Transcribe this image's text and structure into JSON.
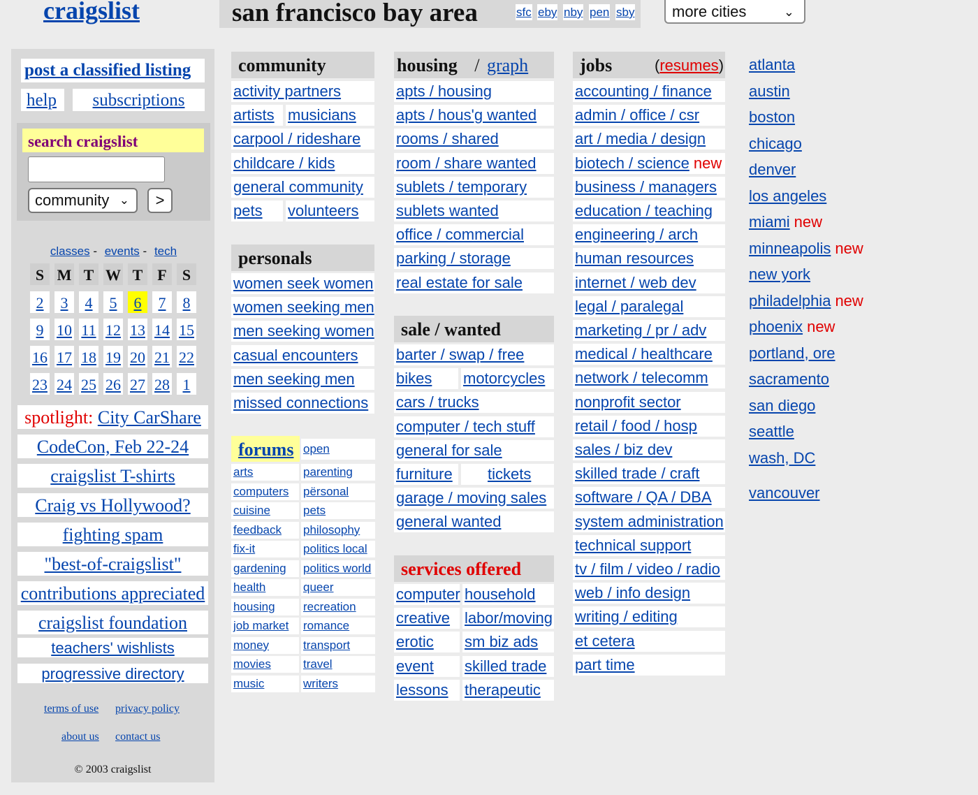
{
  "header": {
    "logo": "craigslist",
    "site_title": "san francisco bay area",
    "subareas": [
      "sfc",
      "eby",
      "nby",
      "pen",
      "sby"
    ],
    "more_cities": "more cities"
  },
  "sidebar": {
    "post_listing": "post a classified listing",
    "help": "help",
    "subscriptions": "subscriptions",
    "search_label": "search craigslist",
    "search_value": "",
    "search_category": "community",
    "go_button": ">",
    "cal_links": [
      "classes",
      "events",
      "tech"
    ],
    "cal_separator": "-",
    "cal_headers": [
      "S",
      "M",
      "T",
      "W",
      "T",
      "F",
      "S"
    ],
    "cal_days": [
      "2",
      "3",
      "4",
      "5",
      "6",
      "7",
      "8",
      "9",
      "10",
      "11",
      "12",
      "13",
      "14",
      "15",
      "16",
      "17",
      "18",
      "19",
      "20",
      "21",
      "22",
      "23",
      "24",
      "25",
      "26",
      "27",
      "28",
      "1"
    ],
    "today": "6",
    "spotlight_label": "spotlight:",
    "spotlight_link": "City CarShare",
    "promo_links": [
      "CodeCon, Feb 22-24",
      "craigslist T-shirts",
      "Craig vs Hollywood?",
      "fighting spam",
      "\"best-of-craigslist\"",
      "contributions appreciated",
      "craigslist foundation"
    ],
    "sans_links": [
      "teachers' wishlists",
      "progressive directory"
    ],
    "footer_links": [
      "terms of use",
      "privacy policy",
      "about us",
      "contact us"
    ],
    "copyright": "© 2003 craigslist"
  },
  "community": {
    "title": "community",
    "rows": [
      [
        "activity partners"
      ],
      [
        "artists",
        "musicians"
      ],
      [
        "carpool / rideshare"
      ],
      [
        "childcare / kids"
      ],
      [
        "general community"
      ],
      [
        "pets",
        "volunteers"
      ]
    ]
  },
  "personals": {
    "title": "personals",
    "rows": [
      "women seek women",
      "women seeking men",
      "men seeking women",
      "casual encounters",
      "men seeking men",
      "missed connections"
    ]
  },
  "forums": {
    "title": "forums",
    "open": "open",
    "left": [
      "arts",
      "computers",
      "cuisine",
      "feedback",
      "fix-it",
      "gardening",
      "health",
      "housing",
      "job market",
      "money",
      "movies",
      "music"
    ],
    "right": [
      "parenting",
      "përsonal",
      "pets",
      "philosophy",
      "politics local",
      "politics world",
      "queer",
      "recreation",
      "romance",
      "transport",
      "travel",
      "writers"
    ]
  },
  "housing": {
    "title": "housing",
    "slash": "/",
    "graph": "graph",
    "rows": [
      "apts / housing",
      "apts / hous'g wanted",
      "rooms / shared",
      "room / share wanted",
      "sublets / temporary",
      "sublets wanted",
      "office / commercial",
      "parking / storage",
      "real estate for sale"
    ]
  },
  "sale": {
    "title": "sale / wanted",
    "rows": [
      [
        "barter / swap / free"
      ],
      [
        "bikes",
        "motorcycles"
      ],
      [
        "cars / trucks"
      ],
      [
        "computer / tech stuff"
      ],
      [
        "general for sale"
      ],
      [
        "furniture",
        "tickets"
      ],
      [
        "garage / moving sales"
      ],
      [
        "general wanted"
      ]
    ]
  },
  "services": {
    "title": "services offered",
    "left": [
      "computer",
      "creative",
      "erotic",
      "event",
      "lessons"
    ],
    "right": [
      "household",
      "labor/moving",
      "sm biz ads",
      "skilled trade",
      "therapeutic"
    ]
  },
  "jobs": {
    "title": "jobs",
    "resumes_open": "(",
    "resumes": "resumes",
    "resumes_close": ")",
    "new_label": "new",
    "rows": [
      "accounting / finance",
      "admin / office / csr",
      "art / media / design",
      "biotech / science",
      "business / managers",
      "education / teaching",
      "engineering / arch",
      "human resources",
      "internet / web dev",
      "legal  /  paralegal",
      "marketing / pr / adv",
      "medical / healthcare",
      "network / telecomm",
      "nonprofit sector",
      "retail / food / hosp",
      "sales / biz dev",
      "skilled trade / craft",
      "software / QA / DBA",
      "system administration",
      "technical support",
      "tv / film / video / radio",
      "web / info design",
      "writing / editing",
      "et cetera",
      "part time"
    ]
  },
  "cities": {
    "new_label": "new",
    "list": [
      "atlanta",
      "austin",
      "boston",
      "chicago",
      "denver",
      "los angeles",
      "miami",
      "minneapolis",
      "new york",
      "philadelphia",
      "phoenix",
      "portland, ore",
      "sacramento",
      "san diego",
      "seattle",
      "wash, DC",
      "vancouver"
    ],
    "new_flags": [
      false,
      false,
      false,
      false,
      false,
      false,
      true,
      true,
      false,
      true,
      true,
      false,
      false,
      false,
      false,
      false,
      false
    ]
  },
  "colors": {
    "link": "#0645ad",
    "new": "#e00000",
    "highlight": "#ffff99",
    "today": "#ffff00"
  }
}
